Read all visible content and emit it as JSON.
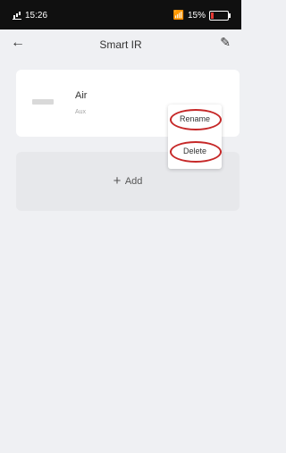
{
  "status": {
    "time": "15:26",
    "battery": "15%"
  },
  "nav": {
    "back": "←",
    "title": "Smart IR",
    "edit": "✎"
  },
  "device": {
    "name": "Air",
    "subtitle": "Aux"
  },
  "add": {
    "label": "Add",
    "plus": "+"
  },
  "menu": {
    "items": [
      "Rename",
      "Delete"
    ]
  },
  "colors": {
    "highlight_ring": "#c62828",
    "background": "#eff0f3"
  }
}
